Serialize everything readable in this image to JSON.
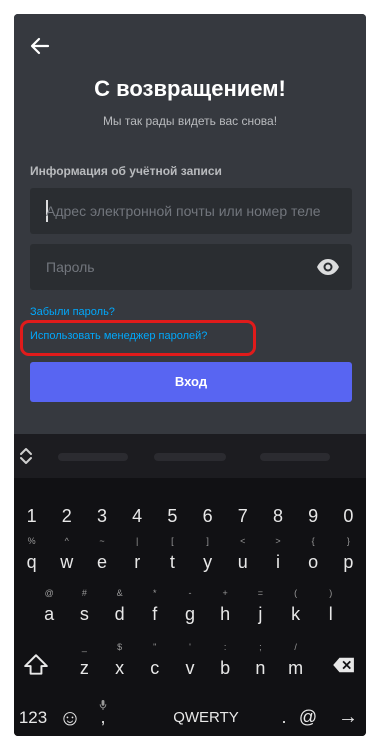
{
  "app": {
    "title": "С возвращением!",
    "subtitle": "Мы так рады видеть вас снова!",
    "section_label": "Информация об учётной записи",
    "email_placeholder": "Адрес электронной почты или номер теле",
    "password_placeholder": "Пароль",
    "forgot_password": "Забыли пароль?",
    "password_manager": "Использовать менеджер паролей?",
    "login_button": "Вход",
    "highlight_color": "#e01b1b"
  },
  "keyboard": {
    "numbers": [
      "1",
      "2",
      "3",
      "4",
      "5",
      "6",
      "7",
      "8",
      "9",
      "0"
    ],
    "row1": [
      [
        "%",
        "q"
      ],
      [
        "^",
        "w"
      ],
      [
        "~",
        "e"
      ],
      [
        "|",
        "r"
      ],
      [
        "[",
        "t"
      ],
      [
        "]",
        "y"
      ],
      [
        "<",
        "u"
      ],
      [
        ">",
        "i"
      ],
      [
        "{",
        "o"
      ],
      [
        "}",
        "p"
      ]
    ],
    "row2": [
      [
        "@",
        "a"
      ],
      [
        "#",
        "s"
      ],
      [
        "&",
        "d"
      ],
      [
        "*",
        "f"
      ],
      [
        "-",
        "g"
      ],
      [
        "+",
        "h"
      ],
      [
        "=",
        "j"
      ],
      [
        "(",
        "k"
      ],
      [
        ")",
        "l"
      ]
    ],
    "row3": [
      [
        "_",
        "z"
      ],
      [
        "$",
        "x"
      ],
      [
        "\"",
        "c"
      ],
      [
        "'",
        "v"
      ],
      [
        ":",
        "b"
      ],
      [
        ";",
        "n"
      ],
      [
        "/",
        "m"
      ]
    ],
    "numeric_key": "123",
    "emoji_key": "☺",
    "comma_key": ",",
    "space_label": "QWERTY",
    "period_key": ".",
    "at_key": "@",
    "enter_key": "→"
  },
  "icons": {
    "back": "arrow-left-icon",
    "eye": "eye-icon",
    "shift": "shift-icon",
    "backspace": "backspace-icon",
    "mic": "mic-icon",
    "cursor": "cursor-arrows-icon"
  }
}
